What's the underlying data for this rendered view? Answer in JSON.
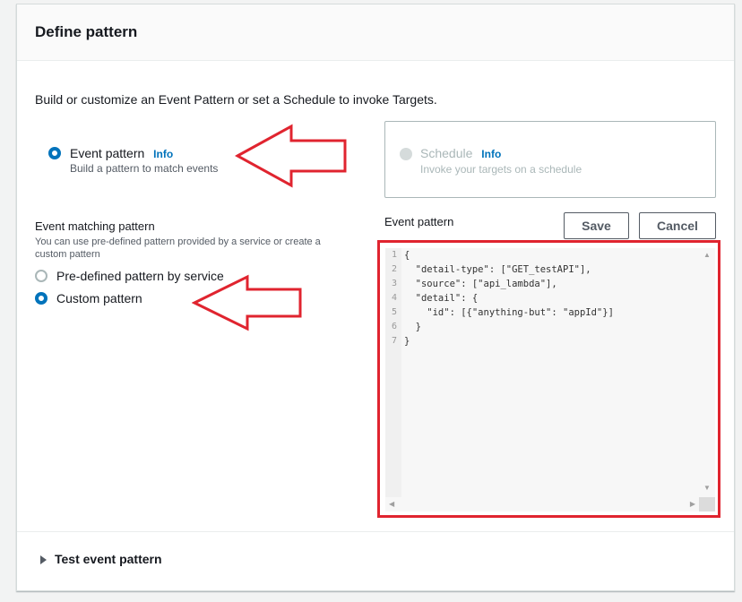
{
  "panel": {
    "title": "Define pattern",
    "description": "Build or customize an Event Pattern or set a Schedule to invoke Targets."
  },
  "options": {
    "event_pattern": {
      "label": "Event pattern",
      "info": "Info",
      "description": "Build a pattern to match events",
      "selected": true
    },
    "schedule": {
      "label": "Schedule",
      "info": "Info",
      "description": "Invoke your targets on a schedule",
      "selected": false
    }
  },
  "matching": {
    "title": "Event matching pattern",
    "description_line1": "You can use pre-defined pattern provided by a service or create a",
    "description_line2": "custom pattern",
    "options": [
      {
        "label": "Pre-defined pattern by service",
        "selected": false
      },
      {
        "label": "Custom pattern",
        "selected": true
      }
    ]
  },
  "editor": {
    "label": "Event pattern",
    "save_label": "Save",
    "cancel_label": "Cancel",
    "line_numbers": [
      "1",
      "2",
      "3",
      "4",
      "5",
      "6",
      "7"
    ],
    "lines": [
      "{",
      "  \"detail-type\": [\"GET_testAPI\"],",
      "  \"source\": [\"api_lambda\"],",
      "  \"detail\": {",
      "    \"id\": [{\"anything-but\": \"appId\"}]",
      "  }",
      "}"
    ]
  },
  "test_section": {
    "label": "Test event pattern"
  },
  "colors": {
    "accent": "#0073bb",
    "highlight": "#e0242f"
  },
  "icons": {
    "annotation_arrow": "left-arrow-icon",
    "expand": "caret-right-icon"
  }
}
